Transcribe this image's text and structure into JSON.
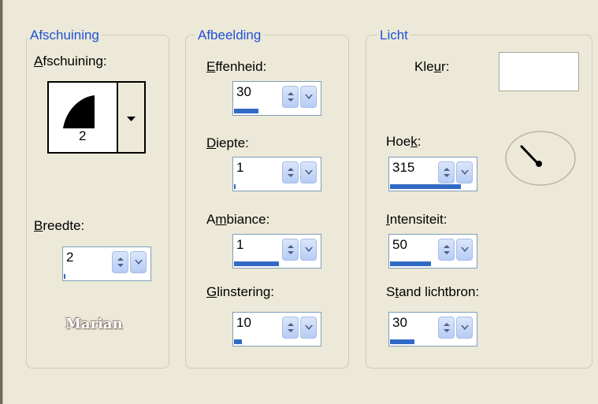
{
  "groups": {
    "bevel": {
      "legend": "Afschuining"
    },
    "image": {
      "legend": "Afbeelding"
    },
    "light": {
      "legend": "Licht"
    }
  },
  "bevel": {
    "label": "Afschuining:",
    "preview_number": "2",
    "width_label": "Breedte:",
    "width_value": "2",
    "width_level": 0.02
  },
  "image": {
    "smoothness_label": "Effenheid:",
    "smoothness_value": "30",
    "smoothness_level": 0.3,
    "depth_label": "Diepte:",
    "depth_value": "1",
    "depth_level": 0.01,
    "ambience_label": "Ambiance:",
    "ambience_value": "1",
    "ambience_level": 0.55,
    "shine_label": "Glinstering:",
    "shine_value": "10",
    "shine_level": 0.1
  },
  "light": {
    "color_label": "Kleur:",
    "color_value": "#ffffff",
    "angle_label": "Hoek:",
    "angle_value": "315",
    "angle_level": 0.875,
    "intensity_label": "Intensiteit:",
    "intensity_value": "50",
    "intensity_level": 0.5,
    "elevation_label": "Stand lichtbron:",
    "elevation_value": "30",
    "elevation_level": 0.3
  },
  "signature": "Marian",
  "icons": {
    "spin_up_down": "spin-arrows-icon",
    "dropdown": "chevron-down-icon",
    "dial": "angle-dial-icon"
  }
}
